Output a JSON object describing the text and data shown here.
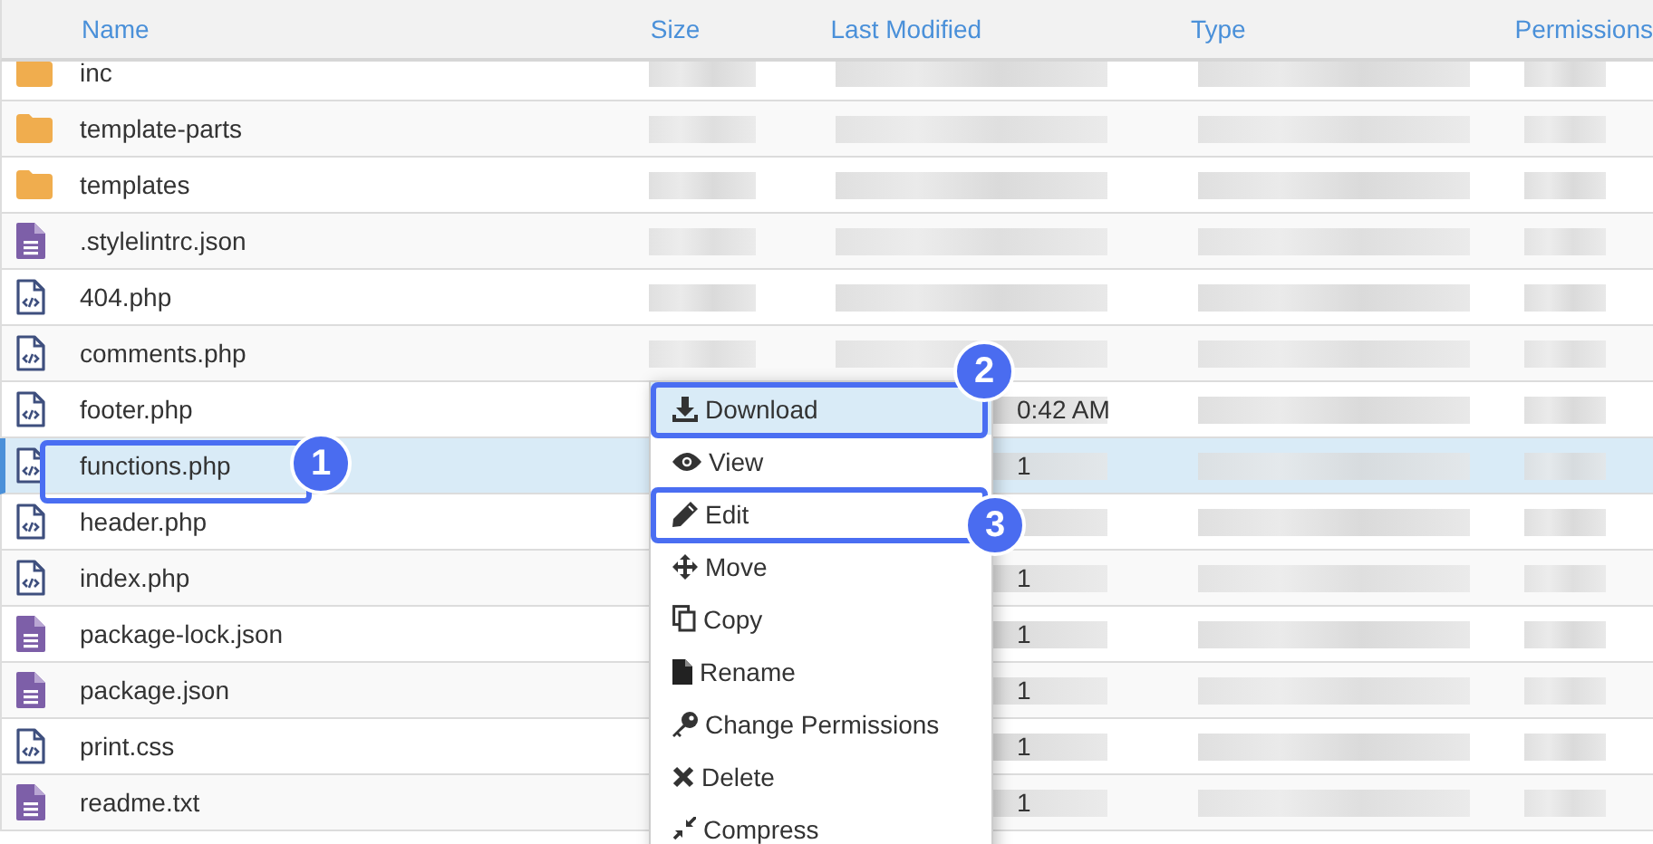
{
  "columns": [
    {
      "label": "Name"
    },
    {
      "label": "Size"
    },
    {
      "label": "Last Modified"
    },
    {
      "label": "Type"
    },
    {
      "label": "Permissions"
    }
  ],
  "rows": [
    {
      "name": "inc",
      "kind": "folder",
      "selected": false
    },
    {
      "name": "template-parts",
      "kind": "folder",
      "selected": false
    },
    {
      "name": "templates",
      "kind": "folder",
      "selected": false
    },
    {
      "name": ".stylelintrc.json",
      "kind": "doc",
      "selected": false
    },
    {
      "name": "404.php",
      "kind": "code",
      "selected": false
    },
    {
      "name": "comments.php",
      "kind": "code",
      "selected": false
    },
    {
      "name": "footer.php",
      "kind": "code",
      "selected": false,
      "modified": "0:42 AM"
    },
    {
      "name": "functions.php",
      "kind": "code",
      "selected": true,
      "modified": "1",
      "callout": "1"
    },
    {
      "name": "header.php",
      "kind": "code",
      "selected": false
    },
    {
      "name": "index.php",
      "kind": "code",
      "selected": false,
      "modified": "1"
    },
    {
      "name": "package-lock.json",
      "kind": "doc",
      "selected": false,
      "modified": "1"
    },
    {
      "name": "package.json",
      "kind": "doc",
      "selected": false,
      "modified": "1"
    },
    {
      "name": "print.css",
      "kind": "code",
      "selected": false,
      "modified": "1"
    },
    {
      "name": "readme.txt",
      "kind": "doc",
      "selected": false,
      "modified": "1"
    }
  ],
  "context_menu": {
    "items": [
      {
        "label": "Download",
        "kind": "download",
        "selected": true,
        "callout": "2"
      },
      {
        "label": "View",
        "kind": "view",
        "selected": false
      },
      {
        "label": "Edit",
        "kind": "edit",
        "selected": false,
        "callout": "3"
      },
      {
        "label": "Move",
        "kind": "move",
        "selected": false
      },
      {
        "label": "Copy",
        "kind": "copy",
        "selected": false
      },
      {
        "label": "Rename",
        "kind": "rename",
        "selected": false
      },
      {
        "label": "Change Permissions",
        "kind": "permissions",
        "selected": false
      },
      {
        "label": "Delete",
        "kind": "delete",
        "selected": false
      },
      {
        "label": "Compress",
        "kind": "compress",
        "selected": false
      }
    ]
  }
}
